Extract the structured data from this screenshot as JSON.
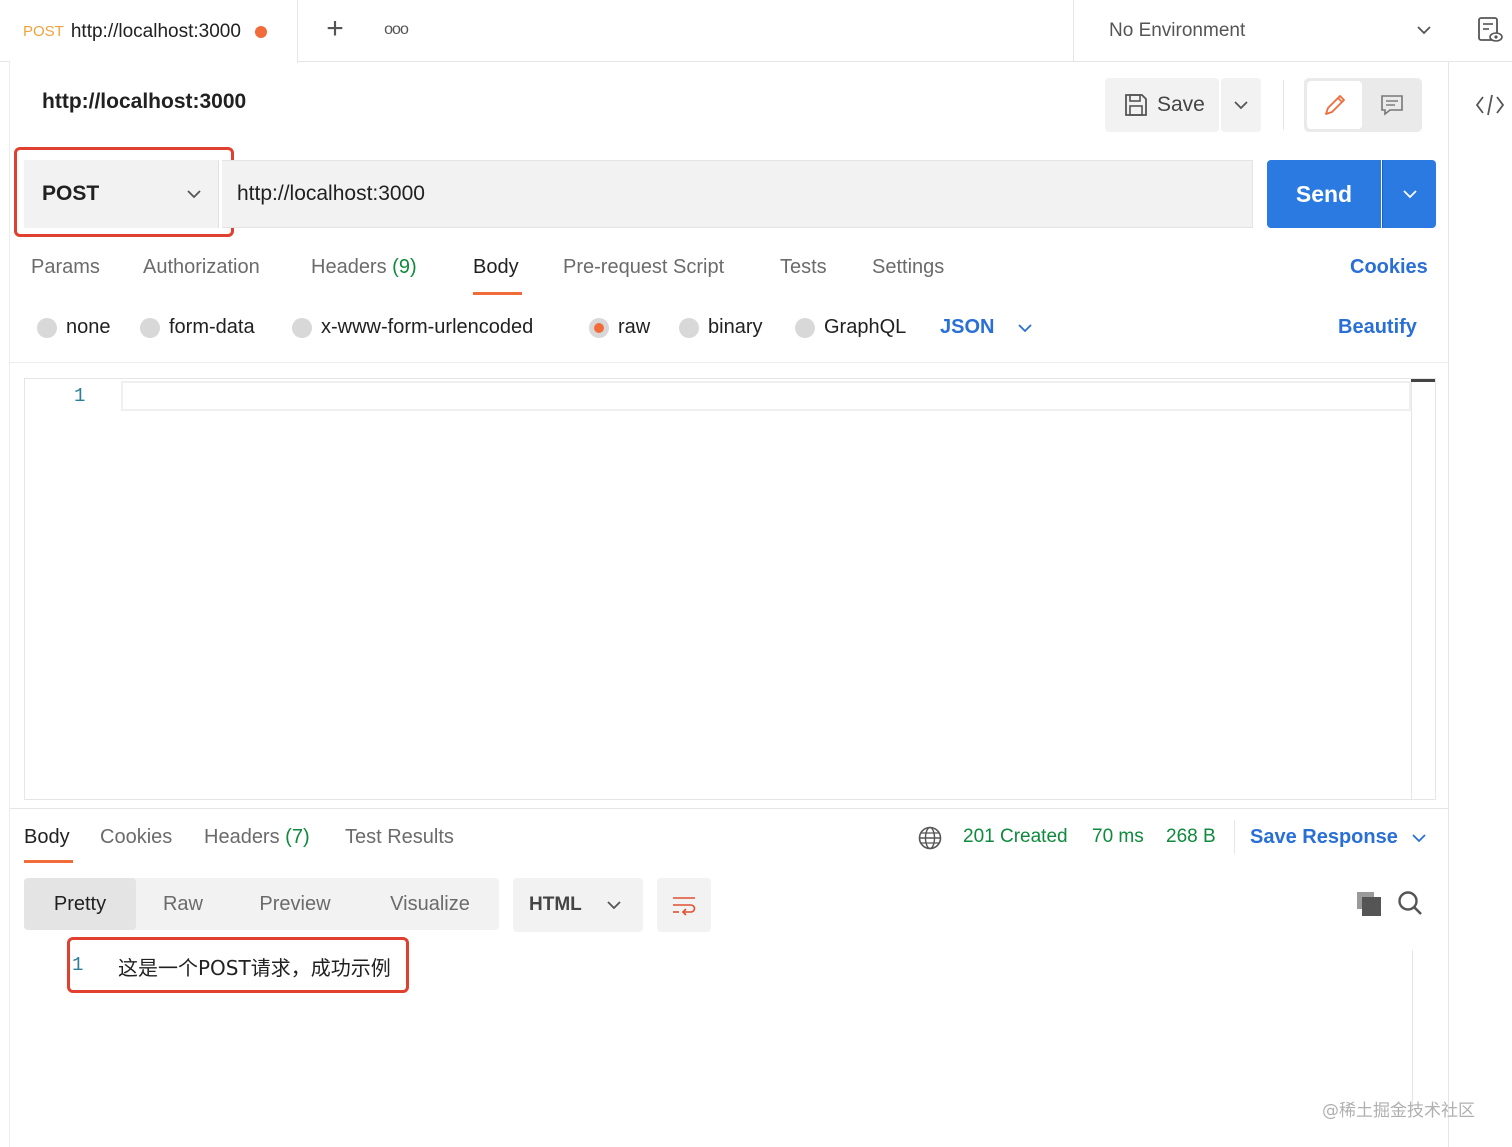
{
  "tab": {
    "method": "POST",
    "url": "http://localhost:3000"
  },
  "environment": {
    "label": "No Environment"
  },
  "request": {
    "title": "http://localhost:3000",
    "save_label": "Save",
    "method": "POST",
    "url": "http://localhost:3000",
    "send_label": "Send"
  },
  "request_tabs": {
    "params": "Params",
    "authorization": "Authorization",
    "headers": "Headers",
    "headers_count": "(9)",
    "body": "Body",
    "prerequest": "Pre-request Script",
    "tests": "Tests",
    "settings": "Settings",
    "cookies": "Cookies"
  },
  "body_types": {
    "none": "none",
    "form_data": "form-data",
    "urlencoded": "x-www-form-urlencoded",
    "raw": "raw",
    "binary": "binary",
    "graphql": "GraphQL",
    "format": "JSON",
    "beautify": "Beautify",
    "selected": "raw"
  },
  "editor": {
    "line_number": "1"
  },
  "response": {
    "tabs": {
      "body": "Body",
      "cookies": "Cookies",
      "headers": "Headers",
      "headers_count": "(7)",
      "test_results": "Test Results"
    },
    "status": "201 Created",
    "time": "70 ms",
    "size": "268 B",
    "save_response": "Save Response",
    "views": {
      "pretty": "Pretty",
      "raw": "Raw",
      "preview": "Preview",
      "visualize": "Visualize"
    },
    "format": "HTML",
    "line_number": "1",
    "body_text": "这是一个POST请求，成功示例"
  },
  "colors": {
    "accent": "#f26b3a",
    "primary": "#2a7ae2",
    "link": "#2a6fd6",
    "success": "#0f8a3c",
    "highlight": "#e0402f"
  },
  "watermark": "@稀土掘金技术社区"
}
